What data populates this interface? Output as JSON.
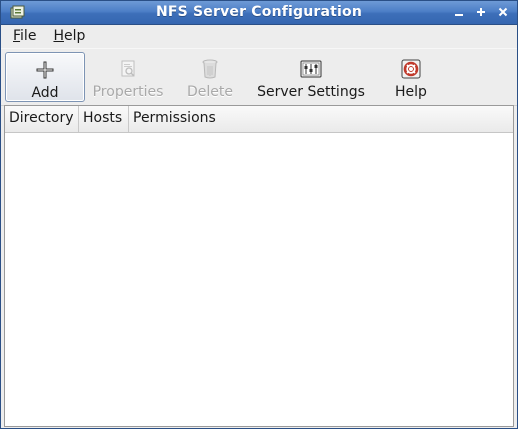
{
  "window": {
    "title": "NFS Server Configuration"
  },
  "menubar": {
    "items": [
      {
        "label": "File",
        "mnemonic": "F",
        "rest": "ile"
      },
      {
        "label": "Help",
        "mnemonic": "H",
        "rest": "elp"
      }
    ]
  },
  "toolbar": {
    "add": {
      "label": "Add",
      "icon": "plus-icon",
      "enabled": true
    },
    "properties": {
      "label": "Properties",
      "icon": "properties-icon",
      "enabled": false
    },
    "delete": {
      "label": "Delete",
      "icon": "trash-icon",
      "enabled": false
    },
    "server_settings": {
      "label": "Server Settings",
      "icon": "settings-icon",
      "enabled": true
    },
    "help": {
      "label": "Help",
      "icon": "lifebuoy-icon",
      "enabled": true
    }
  },
  "table": {
    "columns": [
      "Directory",
      "Hosts",
      "Permissions"
    ],
    "rows": []
  },
  "colors": {
    "titlebar": "#3d6fb9",
    "background": "#ededed"
  }
}
